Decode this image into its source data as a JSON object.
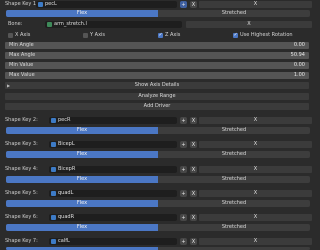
{
  "shape_keys": [
    {
      "label": "Shape Key 1:",
      "value": "pecL"
    },
    {
      "label": "Shape Key 2:",
      "value": "pecR"
    },
    {
      "label": "Shape Key 3:",
      "value": "BicepL"
    },
    {
      "label": "Shape Key 4:",
      "value": "BicepR"
    },
    {
      "label": "Shape Key 5:",
      "value": "quadL"
    },
    {
      "label": "Shape Key 6:",
      "value": "quadR"
    },
    {
      "label": "Shape Key 7:",
      "value": "calfL"
    }
  ],
  "flex_label": "Flex",
  "stretched_label": "Stretched",
  "x_label": "X",
  "add_icon": "+",
  "bone": {
    "label": "Bone:",
    "value": "arm_stretch.l"
  },
  "axes": {
    "x": {
      "label": "X Axis",
      "checked": false
    },
    "y": {
      "label": "Y Axis",
      "checked": false
    },
    "z": {
      "label": "Z Axis",
      "checked": true
    },
    "highest": {
      "label": "Use Highest Rotation",
      "checked": true
    }
  },
  "fields": [
    {
      "label": "Min Angle",
      "value": "0.00"
    },
    {
      "label": "Max Angle",
      "value": "50.94"
    },
    {
      "label": "Min Value",
      "value": "0.00"
    },
    {
      "label": "Max Value",
      "value": "1.00"
    }
  ],
  "buttons": {
    "show_axis": "Show Axis Details",
    "analyze": "Analyze Range",
    "add_driver": "Add Driver"
  },
  "colors": {
    "flex": "#4b77c4",
    "panel": "#2b2b2b",
    "field": "#555555"
  }
}
